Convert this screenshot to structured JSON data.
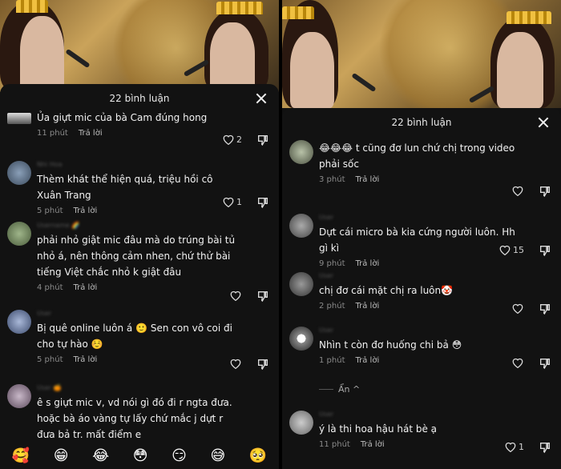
{
  "left": {
    "count_label": "22 bình luận",
    "comments": [
      {
        "text": "Ủa giựt mic của bà Cam đúng hong",
        "time": "11 phút",
        "reply": "Trả lời",
        "likes": "2"
      },
      {
        "text": "Thèm khát thể hiện quá, triệu hồi cô Xuân Trang",
        "time": "5 phút",
        "reply": "Trả lời",
        "likes": "1"
      },
      {
        "text": "phải nhỏ giật mic đâu mà do trúng bài tủ nhỏ á, nên thông cảm nhen, chứ thử bài tiếng Việt chắc nhỏ k giật đâu",
        "time": "4 phút",
        "reply": "Trả lời",
        "likes": ""
      },
      {
        "text": "Bị quê online luôn á 🙂 Sen con vô coi đi cho tự hào ☺️",
        "time": "5 phút",
        "reply": "Trả lời",
        "likes": ""
      },
      {
        "text": "ê s giựt mic v, vd nói gì đó đi r ngta đưa. hoặc bà áo vàng tự lấy chứ mắc j dựt r đưa bả tr. mất điểm e",
        "time": "",
        "reply": "",
        "likes": ""
      }
    ],
    "emojis": [
      "🥰",
      "😁",
      "😂",
      "😳",
      "😏",
      "😅",
      "🥺"
    ]
  },
  "right": {
    "count_label": "22 bình luận",
    "comments": [
      {
        "text": "😂😂😂 t cũng đơ lun chứ chị trong video phải sốc",
        "time": "3 phút",
        "reply": "Trả lời",
        "likes": ""
      },
      {
        "text": "Dựt cái micro bà kia cứng người luôn. Hh gì kì",
        "time": "9 phút",
        "reply": "Trả lời",
        "likes": "15"
      },
      {
        "text": "chị đơ cái mặt chị ra luôn🤡",
        "time": "2 phút",
        "reply": "Trả lời",
        "likes": ""
      },
      {
        "text": "Nhìn t còn đơ huống chi bả 😳",
        "time": "1 phút",
        "reply": "Trả lời",
        "likes": ""
      },
      {
        "text": "ý là thi hoa hậu hát bè ạ",
        "time": "11 phút",
        "reply": "Trả lời",
        "likes": "1"
      }
    ],
    "hide_label": "Ẩn ^"
  },
  "colors": {
    "sheet_bg": "#121212",
    "text": "#f2f2f2",
    "muted": "#8a8a8a"
  },
  "icons": [
    "heart-icon",
    "dislike-icon",
    "close-icon"
  ]
}
